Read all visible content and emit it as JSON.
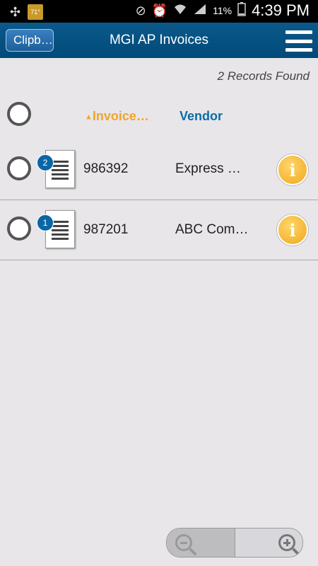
{
  "status_bar": {
    "weather": "71°",
    "battery": "11%",
    "time": "4:39 PM",
    "icons": [
      "network-icon",
      "weather-icon",
      "mute-icon",
      "alarm-icon",
      "wifi-icon",
      "signal-icon",
      "battery-icon"
    ]
  },
  "nav": {
    "back_label": "Clipb…",
    "title": "MGI AP Invoices"
  },
  "records_found": "2 Records Found",
  "columns": {
    "invoice": "Invoice…",
    "vendor": "Vendor"
  },
  "rows": [
    {
      "badge": "2",
      "invoice": "986392",
      "vendor": "Express …"
    },
    {
      "badge": "1",
      "invoice": "987201",
      "vendor": "ABC Com…"
    }
  ],
  "colors": {
    "nav_bg": "#004a78",
    "sort_accent": "#f0a52b",
    "column_blue": "#0a6ea8",
    "badge_blue": "#0a66a5",
    "info_gold": "#f0a81c"
  }
}
